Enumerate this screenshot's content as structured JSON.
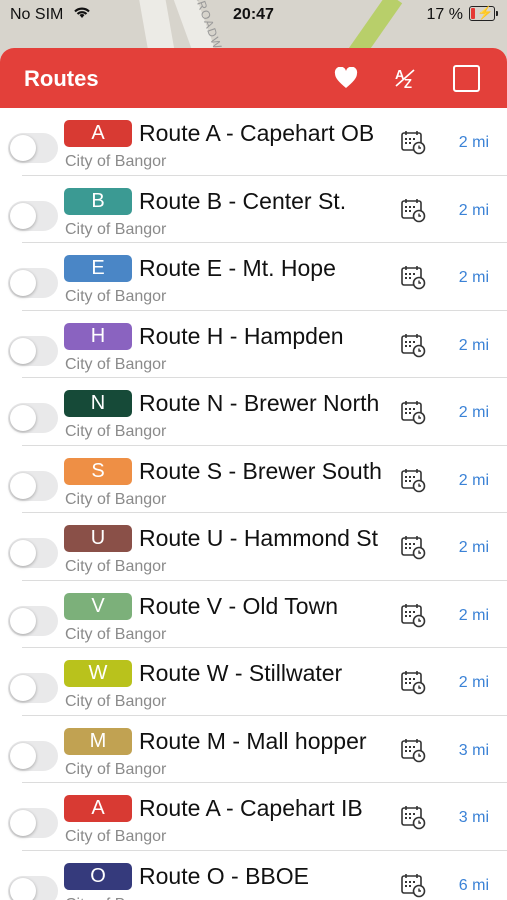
{
  "status": {
    "carrier": "No SIM",
    "time": "20:47",
    "battery": "17 %"
  },
  "map": {
    "street": "BROADW"
  },
  "header": {
    "title": "Routes",
    "heart_icon": "heart-icon",
    "sort_icon": "sort-az-icon",
    "select_icon": "checkbox-icon"
  },
  "routes": [
    {
      "letter": "A",
      "color": "#d83a33",
      "name": "Route A - Capehart OB",
      "agency": "City of Bangor",
      "distance": "2 mi"
    },
    {
      "letter": "B",
      "color": "#3b9a93",
      "name": "Route B - Center St.",
      "agency": "City of Bangor",
      "distance": "2 mi"
    },
    {
      "letter": "E",
      "color": "#4a86c6",
      "name": "Route E - Mt. Hope",
      "agency": "City of Bangor",
      "distance": "2 mi"
    },
    {
      "letter": "H",
      "color": "#8a63c0",
      "name": "Route H - Hampden",
      "agency": "City of Bangor",
      "distance": "2 mi"
    },
    {
      "letter": "N",
      "color": "#164a38",
      "name": "Route N - Brewer North",
      "agency": "City of Bangor",
      "distance": "2 mi"
    },
    {
      "letter": "S",
      "color": "#ee8f45",
      "name": "Route S - Brewer South",
      "agency": "City of Bangor",
      "distance": "2 mi"
    },
    {
      "letter": "U",
      "color": "#8a5048",
      "name": "Route U - Hammond St",
      "agency": "City of Bangor",
      "distance": "2 mi"
    },
    {
      "letter": "V",
      "color": "#7cb07a",
      "name": "Route V - Old Town",
      "agency": "City of Bangor",
      "distance": "2 mi"
    },
    {
      "letter": "W",
      "color": "#b9c21c",
      "name": "Route W - Stillwater",
      "agency": "City of Bangor",
      "distance": "2 mi"
    },
    {
      "letter": "M",
      "color": "#c1a252",
      "name": "Route M - Mall hopper",
      "agency": "City of Bangor",
      "distance": "3 mi"
    },
    {
      "letter": "A",
      "color": "#d83a33",
      "name": "Route A - Capehart IB",
      "agency": "City of Bangor",
      "distance": "3 mi"
    },
    {
      "letter": "O",
      "color": "#353a7c",
      "name": "Route O - BBOE",
      "agency": "City of Bangor",
      "distance": "6 mi"
    }
  ]
}
